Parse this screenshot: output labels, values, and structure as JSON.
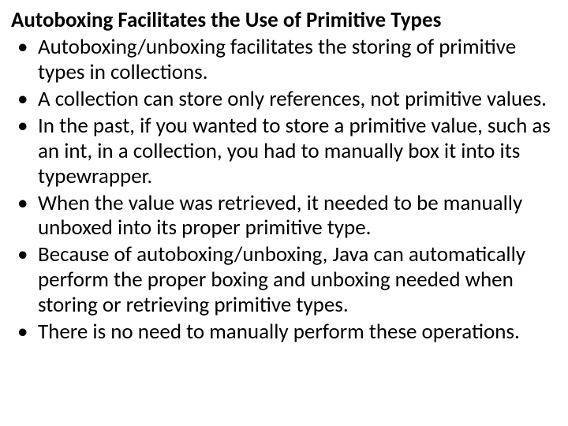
{
  "title": "Autoboxing Facilitates the Use of Primitive Types",
  "bullets": [
    "Autoboxing/unboxing facilitates the storing of primitive types in collections.",
    "A collection can store only references, not primitive values.",
    "In the past, if you wanted to store a primitive value, such as an int, in a collection, you had to manually box it into its typewrapper.",
    "When the value was retrieved, it needed to be manually unboxed into its proper primitive type.",
    "Because of autoboxing/unboxing, Java can automatically perform the proper boxing and unboxing needed when storing or retrieving primitive types.",
    "There is no need to manually perform these operations."
  ]
}
